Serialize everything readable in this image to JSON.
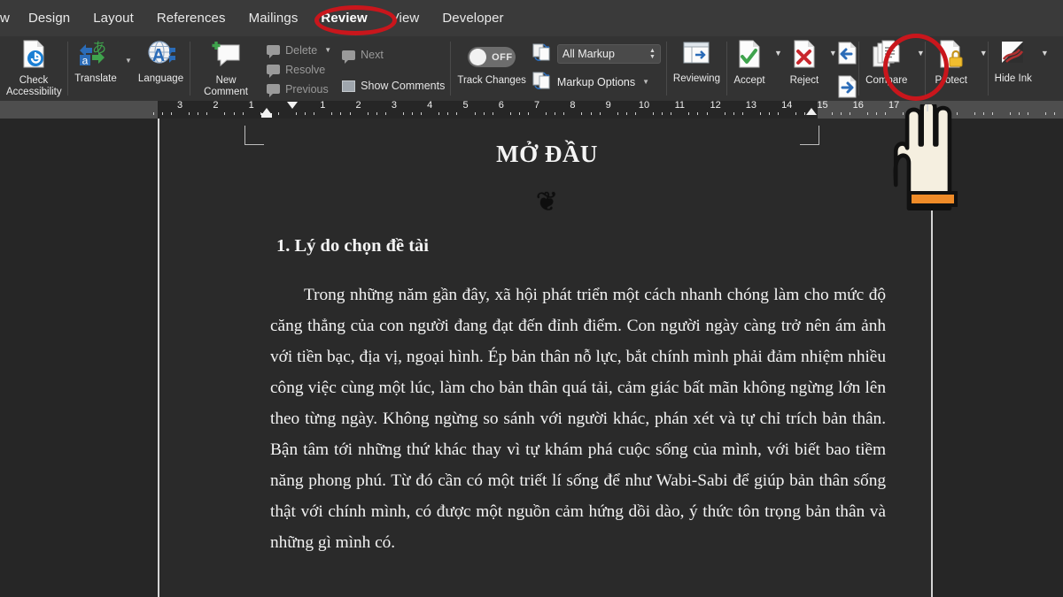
{
  "window": {
    "app": "Microsoft Word",
    "theme": "dark"
  },
  "tabs": [
    {
      "label": "w",
      "active": false,
      "clipped": true
    },
    {
      "label": "Design",
      "active": false
    },
    {
      "label": "Layout",
      "active": false
    },
    {
      "label": "References",
      "active": false
    },
    {
      "label": "Mailings",
      "active": false
    },
    {
      "label": "Review",
      "active": true,
      "highlighted": true
    },
    {
      "label": "View",
      "active": false
    },
    {
      "label": "Developer",
      "active": false
    }
  ],
  "highlight_color": "#c9161c",
  "ribbon": {
    "groups": [
      {
        "name": "accessibility",
        "buttons": [
          {
            "label": "Check\nAccessibility",
            "label_line1": "Check",
            "label_line2": "Accessibility",
            "icon": "check-accessibility-icon"
          }
        ]
      },
      {
        "name": "language",
        "buttons": [
          {
            "label": "Translate",
            "icon": "translate-icon",
            "has_dropdown": true
          },
          {
            "label": "Language",
            "icon": "language-icon"
          }
        ]
      },
      {
        "name": "comments",
        "buttons": [
          {
            "label_line1": "New",
            "label_line2": "Comment",
            "icon": "new-comment-icon"
          }
        ],
        "small_items": [
          {
            "label": "Delete",
            "icon": "delete-comment-icon",
            "has_dropdown": true,
            "disabled": true
          },
          {
            "label": "Resolve",
            "icon": "resolve-comment-icon",
            "disabled": true
          },
          {
            "label": "Previous",
            "icon": "previous-comment-icon",
            "disabled": true
          }
        ],
        "small_items2": [
          {
            "label": "Next",
            "icon": "next-comment-icon",
            "disabled": true
          },
          {
            "label": "Show Comments",
            "icon": "show-comments-icon",
            "disabled": false
          }
        ]
      },
      {
        "name": "tracking",
        "track_changes": {
          "label": "Track Changes",
          "state": "OFF"
        },
        "markup_combo": {
          "value": "All Markup",
          "icon": "markup-view-icon"
        },
        "markup_options": {
          "label": "Markup Options",
          "icon": "markup-options-icon",
          "has_dropdown": true
        }
      },
      {
        "name": "reviewing-pane",
        "buttons": [
          {
            "label": "Reviewing",
            "icon": "reviewing-pane-icon"
          }
        ]
      },
      {
        "name": "changes",
        "buttons": [
          {
            "label": "Accept",
            "icon": "accept-change-icon",
            "has_dropdown": true
          },
          {
            "label": "Reject",
            "icon": "reject-change-icon",
            "has_dropdown": true
          }
        ],
        "nav_buttons": [
          {
            "label": "",
            "icon": "previous-change-icon"
          },
          {
            "label": "",
            "icon": "next-change-icon"
          }
        ]
      },
      {
        "name": "compare",
        "buttons": [
          {
            "label": "Compare",
            "icon": "compare-documents-icon",
            "has_dropdown": true,
            "highlighted": true
          }
        ]
      },
      {
        "name": "protect",
        "buttons": [
          {
            "label": "Protect",
            "icon": "protect-document-icon",
            "has_dropdown": true
          }
        ]
      },
      {
        "name": "ink",
        "buttons": [
          {
            "label": "Hide Ink",
            "icon": "hide-ink-icon",
            "has_dropdown": true
          }
        ]
      }
    ]
  },
  "ruler": {
    "unit": "cm",
    "left_numbers": [
      3,
      2,
      1
    ],
    "right_numbers": [
      1,
      2,
      3,
      4,
      5,
      6,
      7,
      8,
      9,
      10,
      11,
      12,
      13,
      14,
      15,
      16,
      17
    ],
    "left_indent_marker": "1",
    "right_indent_marker": "15"
  },
  "document": {
    "title": "MỞ ĐẦU",
    "ornament": "butterfly-glyph",
    "ornament_char": "❦",
    "heading": "1. Lý do chọn đề tài",
    "paragraph": "Trong những năm gần đây, xã hội phát triển một cách nhanh chóng làm cho mức độ căng thẳng của con người đang đạt đến đỉnh điểm. Con người ngày càng trở nên ám ảnh với tiền bạc, địa vị, ngoại hình. Ép bản thân nỗ lực, bắt chính mình phải đảm nhiệm nhiều công việc cùng một lúc, làm cho bản thân quá tải, cảm giác bất mãn không ngừng lớn lên theo từng ngày. Không ngừng so sánh với người khác, phán xét và tự chỉ trích bản thân. Bận tâm tới những thứ khác thay vì tự khám phá cuộc sống của mình, với biết bao tiềm năng phong phú. Từ đó cần có một triết lí sống để như Wabi-Sabi để giúp bản thân sống thật với chính mình, có được một nguồn cảm hứng dồi dào, ý thức tôn trọng bản thân và những gì mình có."
  },
  "cursor": {
    "type": "pointing-hand-cursor",
    "target": "Compare"
  }
}
